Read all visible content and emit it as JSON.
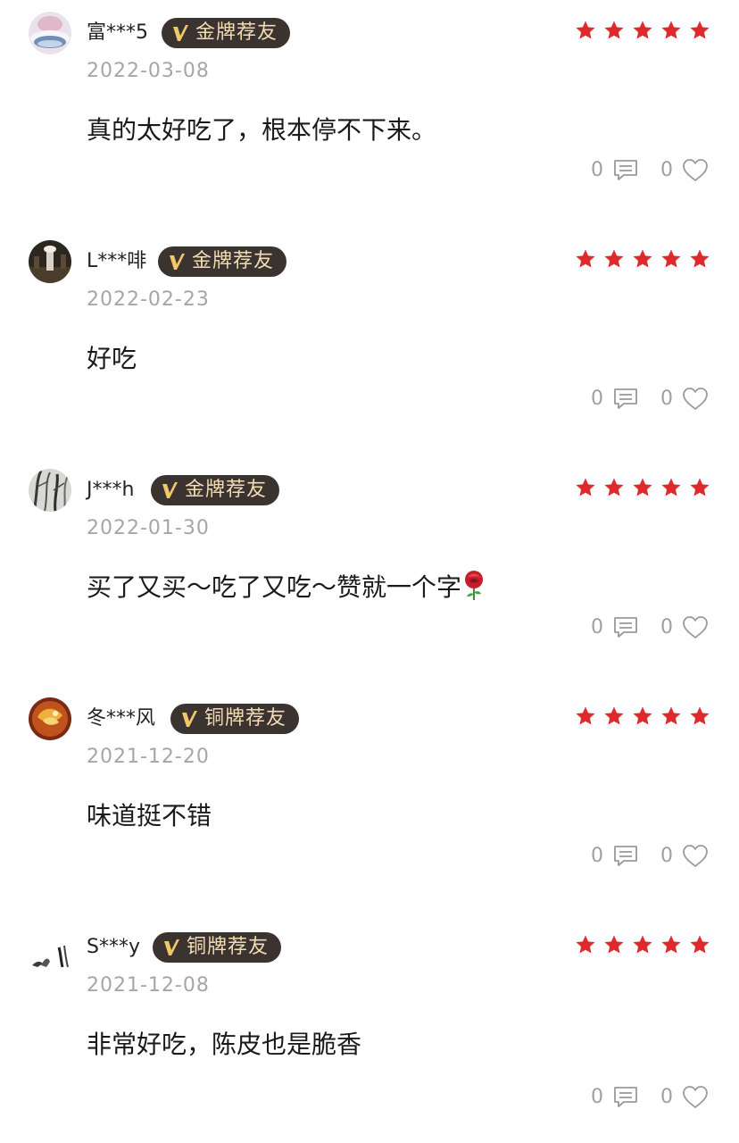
{
  "colors": {
    "star": "#e0292e",
    "badge_bg": "#3a3330",
    "badge_text": "#f3dcb3",
    "date": "#a6a6a6",
    "count": "#a0a0a0"
  },
  "reviews": [
    {
      "username": "富***5",
      "badge": "金牌荐友",
      "rating": 5,
      "date": "2022-03-08",
      "content": "真的太好吃了，根本停不下来。",
      "comment_count": "0",
      "like_count": "0"
    },
    {
      "username": "L***啡",
      "badge": "金牌荐友",
      "rating": 5,
      "date": "2022-02-23",
      "content": "好吃",
      "comment_count": "0",
      "like_count": "0"
    },
    {
      "username": "J***h",
      "badge": "金牌荐友",
      "rating": 5,
      "date": "2022-01-30",
      "content": "买了又买～吃了又吃～赞就一个字",
      "content_emoji": "rose-icon",
      "comment_count": "0",
      "like_count": "0"
    },
    {
      "username": "冬***风",
      "badge": "铜牌荐友",
      "rating": 5,
      "date": "2021-12-20",
      "content": "味道挺不错",
      "comment_count": "0",
      "like_count": "0"
    },
    {
      "username": "S***y",
      "badge": "铜牌荐友",
      "rating": 5,
      "date": "2021-12-08",
      "content": "非常好吃，陈皮也是脆香",
      "comment_count": "0",
      "like_count": "0"
    }
  ]
}
